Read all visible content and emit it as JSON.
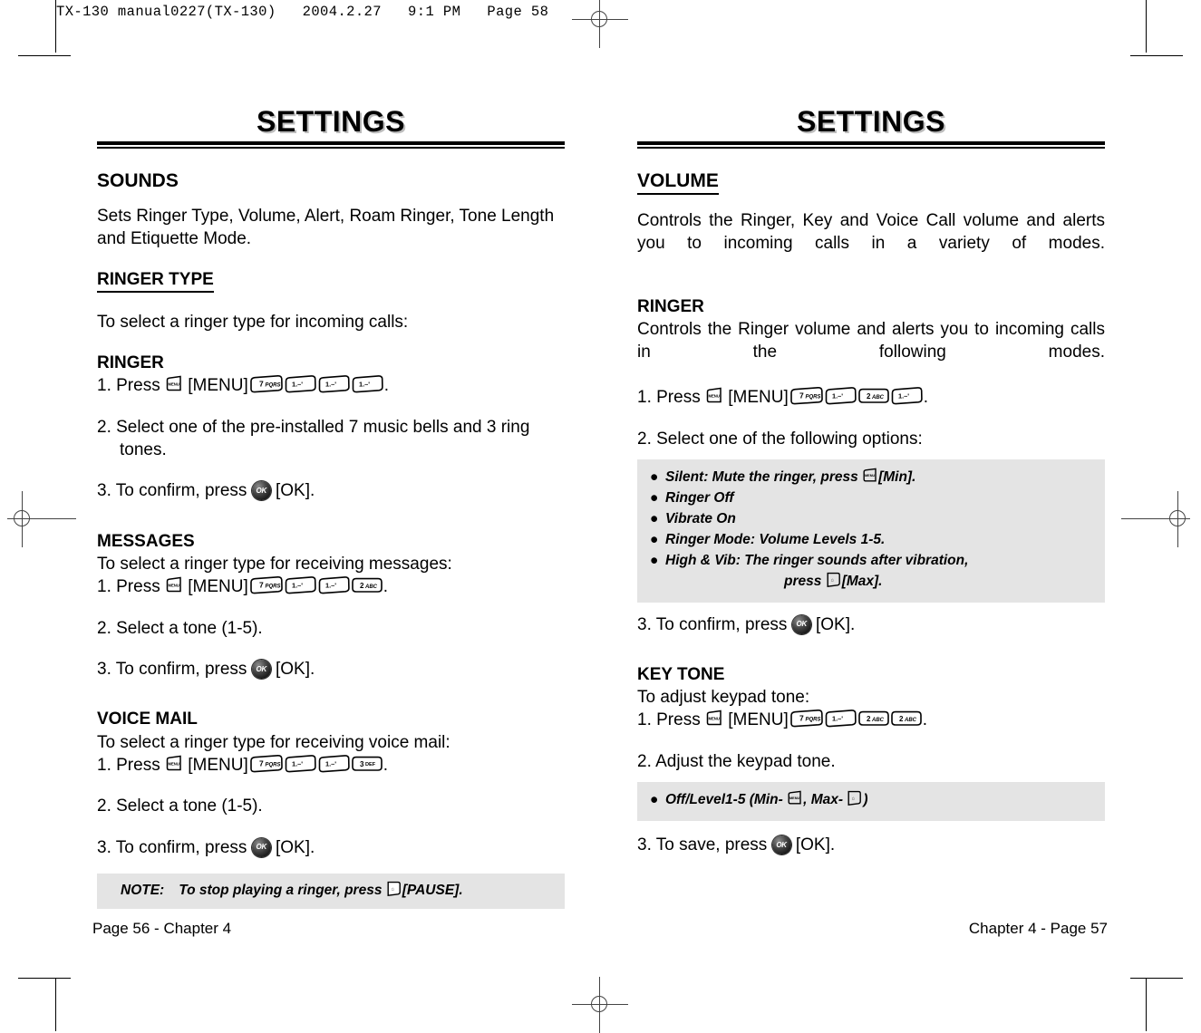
{
  "prepress": {
    "header": "TX-130 manual0227(TX-130)   2004.2.27   9:1 PM   Page 58"
  },
  "left_column": {
    "title": "SETTINGS",
    "section": "SOUNDS",
    "intro": "Sets Ringer Type, Volume, Alert, Roam Ringer, Tone Length and Etiquette Mode.",
    "ringer_type_head": "RINGER TYPE",
    "ringer_type_intro": "To select a ringer type for incoming calls:",
    "ringer": {
      "head": "RINGER",
      "step1_prefix": "1. Press",
      "step1_menu": "[MENU]",
      "step1_period": ".",
      "keys": [
        "7PQRS",
        "1",
        "1",
        "1"
      ],
      "step2": "2. Select one of the pre-installed 7 music bells and 3 ring tones.",
      "step3_prefix": "3. To confirm, press",
      "step3_ok": "[OK]."
    },
    "messages": {
      "head": "MESSAGES",
      "intro": "To select a ringer type for receiving messages:",
      "step1_prefix": "1. Press",
      "step1_menu": "[MENU]",
      "step1_period": ".",
      "keys": [
        "7PQRS",
        "1",
        "1",
        "2ABC"
      ],
      "step2": "2. Select a tone (1-5).",
      "step3_prefix": "3. To confirm, press",
      "step3_ok": "[OK]."
    },
    "voice_mail": {
      "head": "VOICE MAIL",
      "intro": "To select a ringer type for receiving voice mail:",
      "step1_prefix": "1. Press",
      "step1_menu": "[MENU]",
      "step1_period": ".",
      "keys": [
        "7PQRS",
        "1",
        "1",
        "3DEF"
      ],
      "step2": "2. Select a tone (1-5).",
      "step3_prefix": "3. To confirm, press",
      "step3_ok": "[OK]."
    },
    "note": {
      "label": "NOTE:",
      "text_before": "To stop playing a ringer, press",
      "text_after": "[PAUSE]."
    },
    "footer": "Page 56 - Chapter 4"
  },
  "right_column": {
    "title": "SETTINGS",
    "section": "VOLUME",
    "intro": "Controls the Ringer, Key and Voice Call volume and alerts you to incoming calls in a variety of modes.",
    "ringer": {
      "head": "RINGER",
      "intro": "Controls the Ringer volume and alerts you to incoming calls in the following modes.",
      "step1_prefix": "1. Press",
      "step1_menu": "[MENU]",
      "step1_period": ".",
      "keys": [
        "7PQRS",
        "1",
        "2ABC",
        "1"
      ],
      "step2": "2. Select one of the following options:",
      "options": [
        {
          "text_before": "Silent: Mute the ringer, press",
          "icon": "menu-softkey",
          "text_after": "[Min]."
        },
        {
          "text_before": "Ringer Off",
          "icon": null,
          "text_after": ""
        },
        {
          "text_before": "Vibrate On",
          "icon": null,
          "text_after": ""
        },
        {
          "text_before": "Ringer Mode: Volume Levels 1-5.",
          "icon": null,
          "text_after": ""
        },
        {
          "text_before": "High & Vib: The ringer sounds after vibration,",
          "icon": null,
          "text_after": ""
        }
      ],
      "options_indent_before": "press",
      "options_indent_after": "[Max].",
      "step3_prefix": "3. To confirm, press",
      "step3_ok": "[OK]."
    },
    "key_tone": {
      "head": "KEY TONE",
      "intro": "To adjust keypad tone:",
      "step1_prefix": "1. Press",
      "step1_menu": "[MENU]",
      "step1_period": ".",
      "keys": [
        "7PQRS",
        "1",
        "2ABC",
        "2ABC"
      ],
      "step2": "2. Adjust the keypad tone.",
      "level_box_before": "Off/Level1-5 (Min-",
      "level_box_middle": ", Max-",
      "level_box_after": ")",
      "step3_prefix": "3. To save, press",
      "step3_ok": "[OK]."
    },
    "footer": "Chapter 4 - Page 57"
  },
  "icons": {
    "ok_label": "OK",
    "menu_label": "MENU",
    "key_1": "1.–'",
    "key_7": "7",
    "key_7_sub": "PQRS",
    "key_2": "2",
    "key_2_sub": "ABC",
    "key_3": "3",
    "key_3_sub": "DEF"
  }
}
